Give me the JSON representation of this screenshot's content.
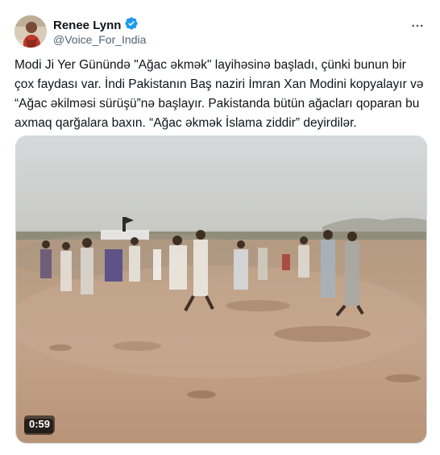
{
  "author": {
    "name": "Renee Lynn",
    "handle": "@Voice_For_India",
    "verified": true,
    "avatar_icon": "profile-photo"
  },
  "tweet": {
    "text": "Modi Ji Yer Günündə \"Ağac əkmək\" layihəsinə başladı, çünki bunun bir çox faydası var. İndi Pakistanın Baş naziri İmran Xan Modini kopyalayır və “Ağac əkilməsi sürüşü”nə başlayır. Pakistanda bütün ağacları qoparan bu axmaq qarğalara baxın. “Ağac əkmək İslama ziddir” deyirdilər."
  },
  "media": {
    "type": "video",
    "duration": "0:59"
  },
  "icons": {
    "verified": "verified-badge-icon",
    "more": "more-options-icon"
  },
  "colors": {
    "verified_blue": "#1d9bf0",
    "secondary_text": "#536471"
  }
}
